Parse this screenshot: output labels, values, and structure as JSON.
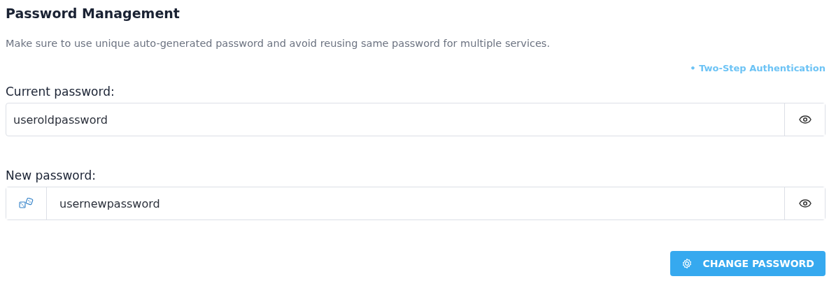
{
  "title": "Password Management",
  "description": "Make sure to use unique auto-generated password and avoid reusing same password for multiple services.",
  "link": "• Two-Step Authentication",
  "fields": [
    {
      "label": "Current password:",
      "value": "useroldpassword",
      "generator": false
    },
    {
      "label": "New password:",
      "value": "usernewpassword",
      "generator": true
    }
  ],
  "button": "CHANGE PASSWORD"
}
